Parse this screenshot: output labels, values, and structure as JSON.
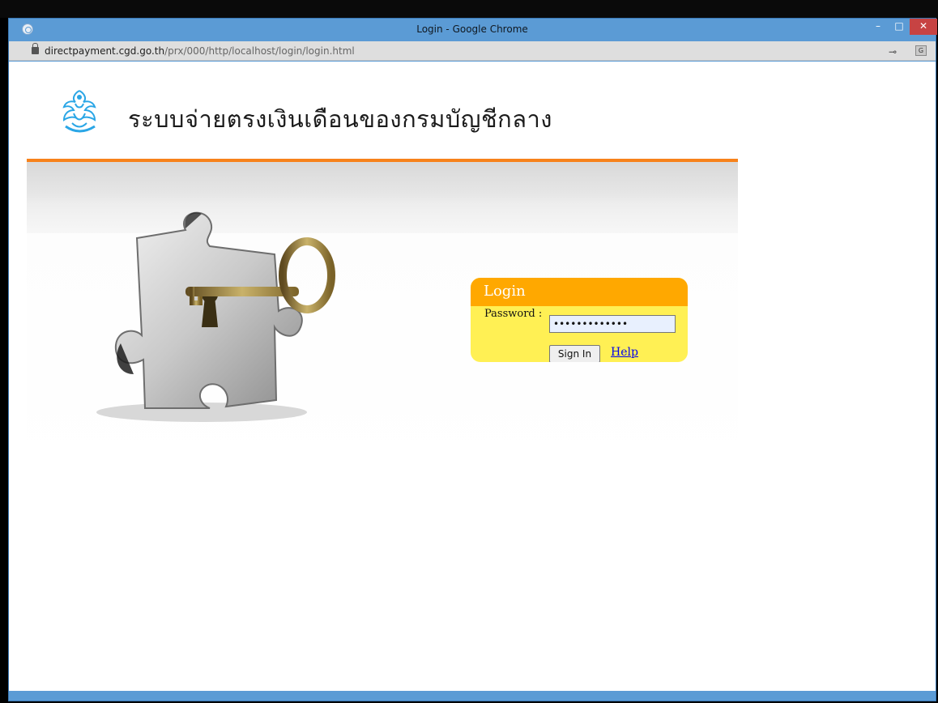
{
  "window": {
    "title": "Login - Google Chrome",
    "minimize": "–",
    "maximize": "□",
    "close": "✕"
  },
  "address_bar": {
    "host": "directpayment.cgd.go.th",
    "path": "/prx/000/http/localhost/login/login.html"
  },
  "header": {
    "site_title": "ระบบจ่ายตรงเงินเดือนของกรมบัญชีกลาง",
    "logo_text": "กรมบัญชีกลาง"
  },
  "login": {
    "title": "Login",
    "password_label": "Password :",
    "password_value": "•••••••••••••",
    "sign_in_label": "Sign In",
    "help_label": "Help"
  },
  "colors": {
    "accent_orange": "#f7821b",
    "login_header": "#ffa800",
    "login_body": "#fff054",
    "titlebar": "#5b9bd5"
  },
  "icons": [
    "chrome-app-icon",
    "lock-icon",
    "key-icon",
    "translate-icon",
    "garuda-logo",
    "puzzle-key-illustration"
  ]
}
